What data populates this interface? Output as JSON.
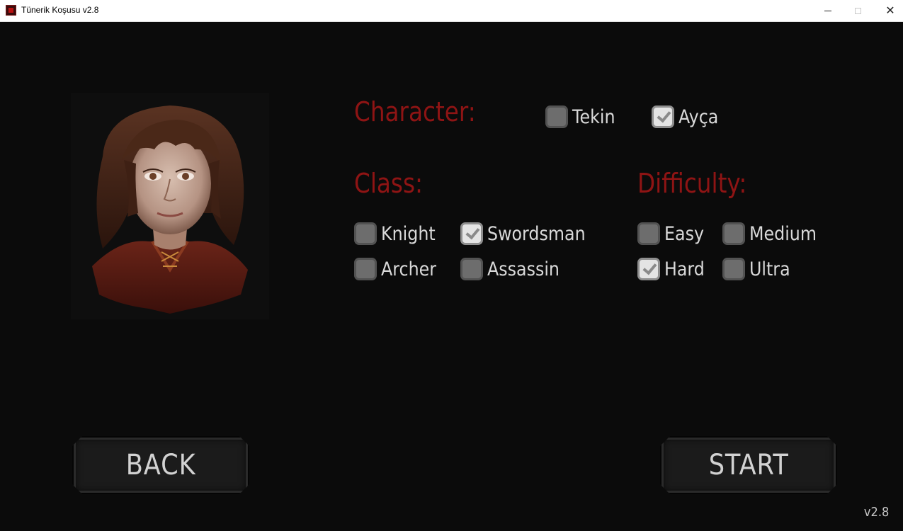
{
  "window": {
    "title": "Tünerik Koşusu v2.8",
    "close_symbol": "✕"
  },
  "character": {
    "heading": "Character:",
    "options": [
      {
        "label": "Tekin",
        "checked": false
      },
      {
        "label": "Ayça",
        "checked": true
      }
    ]
  },
  "class": {
    "heading": "Class:",
    "options": [
      {
        "label": "Knight",
        "checked": false
      },
      {
        "label": "Swordsman",
        "checked": true
      },
      {
        "label": "Archer",
        "checked": false
      },
      {
        "label": "Assassin",
        "checked": false
      }
    ]
  },
  "difficulty": {
    "heading": "Difficulty:",
    "options": [
      {
        "label": "Easy",
        "checked": false
      },
      {
        "label": "Medium",
        "checked": false
      },
      {
        "label": "Hard",
        "checked": true
      },
      {
        "label": "Ultra",
        "checked": false
      }
    ]
  },
  "buttons": {
    "back": "BACK",
    "start": "START"
  },
  "version": "v2.8",
  "colors": {
    "heading": "#8e1414",
    "background": "#0b0b0b",
    "text": "#d9d9d9"
  }
}
